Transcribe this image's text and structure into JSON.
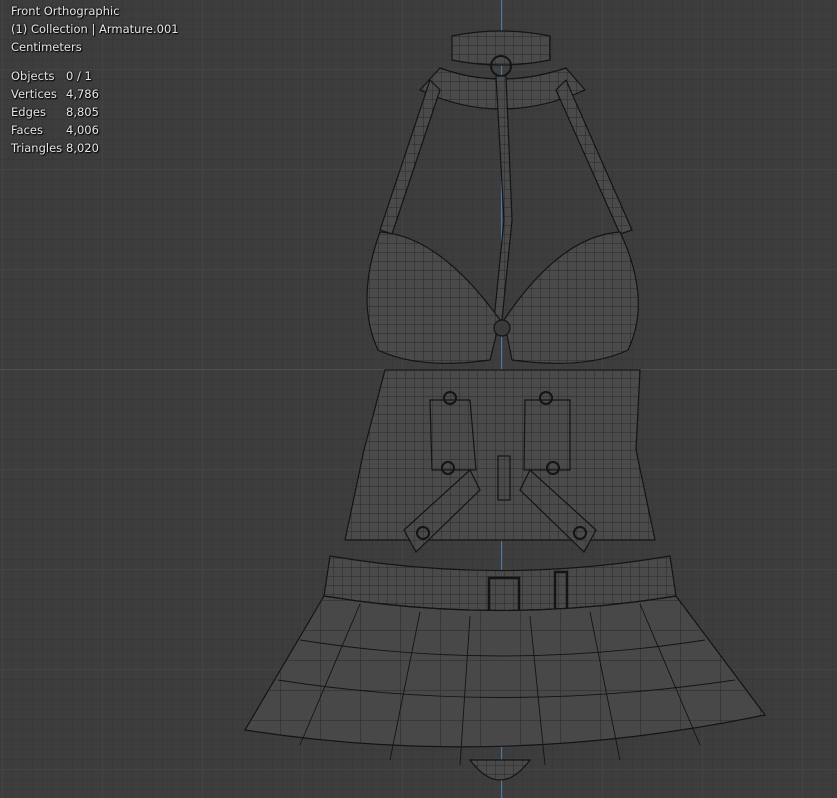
{
  "viewport": {
    "view_name": "Front Orthographic",
    "collection_line": "(1) Collection | Armature.001",
    "units": "Centimeters",
    "stats": [
      {
        "label": "Objects",
        "value": "0 / 1"
      },
      {
        "label": "Vertices",
        "value": "4,786"
      },
      {
        "label": "Edges",
        "value": "8,805"
      },
      {
        "label": "Faces",
        "value": "4,006"
      },
      {
        "label": "Triangles",
        "value": "8,020"
      }
    ]
  },
  "colors": {
    "background": "#3d3d3d",
    "z_axis": "#4a78a8",
    "wire": "#111111",
    "mesh_fill": "#4a4a4a"
  }
}
